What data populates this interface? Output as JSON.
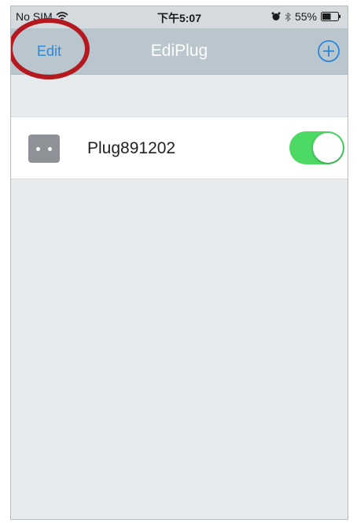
{
  "status_bar": {
    "carrier": "No SIM",
    "time": "下午5:07",
    "battery_percent": "55%",
    "battery_level": 0.55,
    "icons": [
      "wifi-icon",
      "alarm-icon",
      "bluetooth-icon",
      "battery-icon"
    ]
  },
  "nav": {
    "edit_label": "Edit",
    "title": "EdiPlug",
    "add_icon": "plus-circle-icon",
    "accent_color": "#2d86d8",
    "highlight_color": "#b3191f"
  },
  "devices": [
    {
      "name": "Plug891202",
      "icon": "plug-icon",
      "switch_on": true,
      "switch_color": "#4cd964"
    }
  ]
}
